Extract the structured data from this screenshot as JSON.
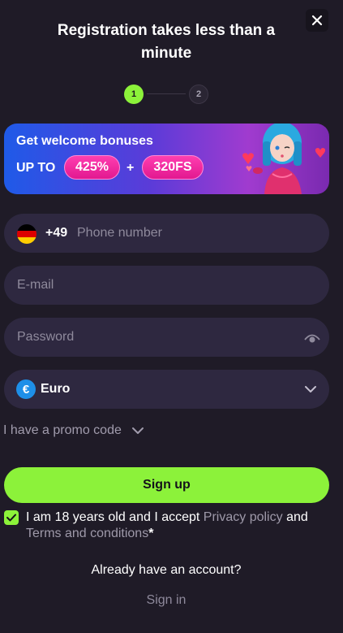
{
  "header": {
    "title": "Registration takes less than a minute",
    "close_icon": "close-icon"
  },
  "stepper": {
    "steps": [
      "1",
      "2"
    ],
    "active_step": 1
  },
  "banner": {
    "title": "Get welcome bonuses",
    "up_to": "UP TO",
    "bonus_percent": "425%",
    "plus": "+",
    "free_spins": "320FS",
    "image": "character-illustration"
  },
  "form": {
    "phone": {
      "country_flag": "germany-flag-icon",
      "prefix": "+49",
      "placeholder": "Phone number"
    },
    "email": {
      "placeholder": "E-mail"
    },
    "password": {
      "placeholder": "Password",
      "icon": "eye-icon"
    },
    "currency": {
      "icon": "euro-icon",
      "symbol": "€",
      "value": "Euro",
      "icon_dropdown": "chevron-down-icon"
    }
  },
  "promo": {
    "label": "I have a promo code",
    "icon": "chevron-down-icon"
  },
  "signup_button": {
    "label": "Sign up"
  },
  "consent": {
    "checked": true,
    "text_before": "I am 18 years old and I accept",
    "privacy_link": "Privacy policy",
    "and": "and",
    "terms_link": "Terms and conditions",
    "required_mark": "*"
  },
  "footer": {
    "already_text": "Already have an account?",
    "signin_label": "Sign in"
  },
  "colors": {
    "background": "#1f1b27",
    "field_bg": "#2e2840",
    "accent_green": "#8cf23a",
    "muted_text": "#8f8a9c",
    "pill_pink": "#e21890"
  }
}
